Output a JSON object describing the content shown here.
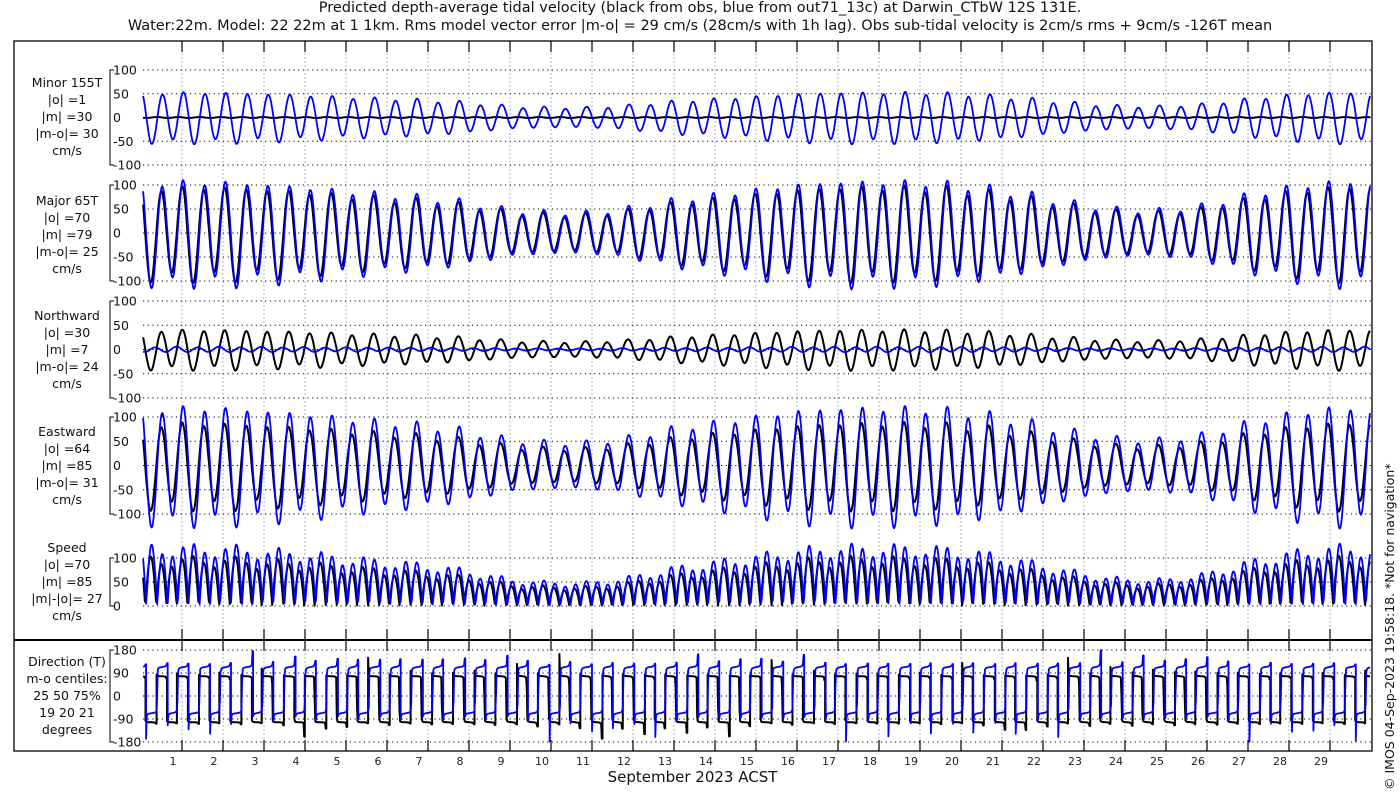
{
  "title_line1": "Predicted depth-average tidal velocity (black from obs, blue from out71_13c) at Darwin_CTbW 12S 131E.",
  "title_line2": "Water:22m. Model: 22 22m at 1 1km. Rms model vector error |m-o| = 29 cm/s (28cm/s with 1h lag). Obs sub-tidal velocity is 2cm/s rms + 9cm/s -126T mean",
  "xlabel": "September 2023 ACST",
  "copyright": "© IMOS 04-Sep-2023 19:58:18. *Not for navigation*",
  "colors": {
    "obs": "#000000",
    "model": "#0000ff",
    "grid": "#000000",
    "day_lines": "#aab4ee"
  },
  "panels": [
    {
      "lines": [
        "Minor 155T",
        "|o| =1",
        "|m| =30",
        "|m-o|= 30",
        "cm/s"
      ],
      "ticks": [
        100,
        50,
        0,
        -50,
        -100
      ],
      "ylim": [
        -100,
        100
      ]
    },
    {
      "lines": [
        "Major 65T",
        "|o| =70",
        "|m| =79",
        "|m-o|= 25",
        "cm/s"
      ],
      "ticks": [
        100,
        50,
        0,
        -50,
        -100
      ],
      "ylim": [
        -100,
        100
      ]
    },
    {
      "lines": [
        "Northward",
        "|o| =30",
        "|m| =7",
        "|m-o|= 24",
        "cm/s"
      ],
      "ticks": [
        100,
        50,
        0,
        -50,
        -100
      ],
      "ylim": [
        -100,
        100
      ]
    },
    {
      "lines": [
        "Eastward",
        "|o| =64",
        "|m| =85",
        "|m-o|= 31",
        "cm/s"
      ],
      "ticks": [
        100,
        50,
        0,
        -50,
        -100
      ],
      "ylim": [
        -100,
        100
      ]
    },
    {
      "lines": [
        "Speed",
        "|o| =70",
        "|m| =85",
        "|m|-|o|= 27",
        "cm/s"
      ],
      "ticks": [
        100,
        50,
        0
      ],
      "ylim": [
        0,
        100
      ]
    },
    {
      "lines": [
        "Direction (T)",
        "m-o centiles:",
        "25  50  75%",
        "19  20  21",
        "degrees"
      ],
      "ticks": [
        180,
        90,
        0,
        -90,
        -180
      ],
      "ylim": [
        -180,
        180
      ]
    }
  ],
  "chart_data": {
    "type": "line",
    "title": "Predicted depth-average tidal velocity (black from obs, blue from out71_13c) at Darwin_CTbW 12S 131E.",
    "xlabel": "September 2023 ACST",
    "x_tick_labels": [
      "1",
      "2",
      "3",
      "4",
      "5",
      "6",
      "7",
      "8",
      "9",
      "10",
      "11",
      "12",
      "13",
      "14",
      "15",
      "16",
      "17",
      "18",
      "19",
      "20",
      "21",
      "22",
      "23",
      "24",
      "25",
      "26",
      "27",
      "28",
      "29"
    ],
    "xlim_days": [
      0,
      30
    ],
    "grid": true,
    "series": [
      "obs (black)",
      "model (blue)"
    ],
    "major_axis_deg": 65,
    "minor_axis_deg": 155,
    "major_obs_amplitude_by_day_cms": [
      100,
      100,
      100,
      95,
      90,
      82,
      76,
      70,
      60,
      45,
      40,
      40,
      50,
      65,
      75,
      85,
      95,
      100,
      100,
      100,
      95,
      85,
      70,
      55,
      45,
      45,
      55,
      75,
      90,
      100,
      100
    ],
    "model_to_obs_major_ratio": 1.12,
    "model_minor_amplitude_ratio": 0.55,
    "obs_minor_amplitude_cms": 1
  }
}
